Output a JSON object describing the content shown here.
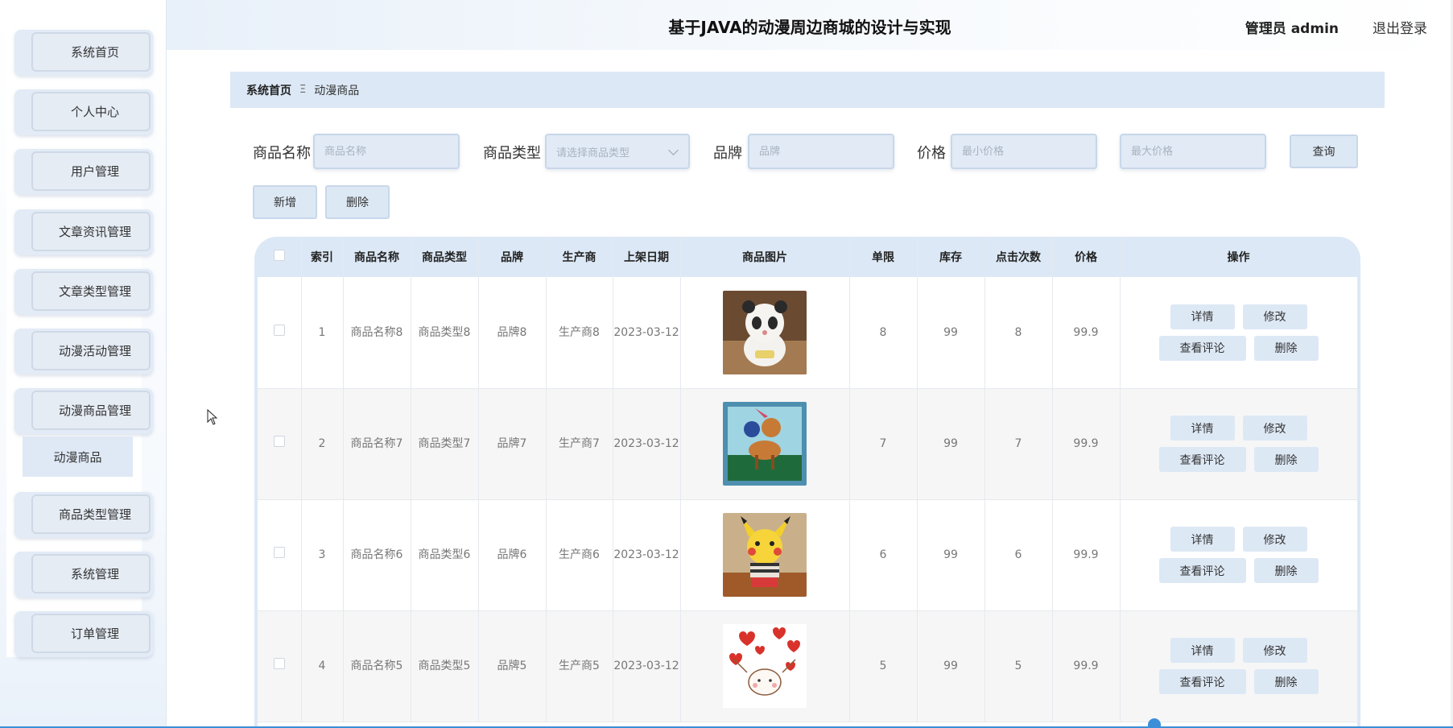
{
  "header": {
    "title": "基于JAVA的动漫周边商城的设计与实现",
    "user": "管理员 admin",
    "logout": "退出登录"
  },
  "sidebar": {
    "items": [
      {
        "label": "系统首页"
      },
      {
        "label": "个人中心"
      },
      {
        "label": "用户管理"
      },
      {
        "label": "文章资讯管理"
      },
      {
        "label": "文章类型管理"
      },
      {
        "label": "动漫活动管理"
      },
      {
        "label": "动漫商品管理"
      },
      {
        "label": "商品类型管理"
      },
      {
        "label": "系统管理"
      },
      {
        "label": "订单管理"
      }
    ],
    "submenu": {
      "label": "动漫商品"
    }
  },
  "breadcrumb": {
    "home": "系统首页",
    "separator": "Ξ",
    "current": "动漫商品"
  },
  "search": {
    "name_label": "商品名称",
    "name_placeholder": "商品名称",
    "type_label": "商品类型",
    "type_placeholder": "请选择商品类型",
    "brand_label": "品牌",
    "brand_placeholder": "品牌",
    "price_label": "价格",
    "min_price_placeholder": "最小价格",
    "max_price_placeholder": "最大价格",
    "query_button": "查询"
  },
  "actions": {
    "add": "新增",
    "delete": "删除"
  },
  "table": {
    "columns": [
      "索引",
      "商品名称",
      "商品类型",
      "品牌",
      "生产商",
      "上架日期",
      "商品图片",
      "单限",
      "库存",
      "点击次数",
      "价格",
      "操作"
    ],
    "rows": [
      {
        "index": "1",
        "name": "商品名称8",
        "type": "商品类型8",
        "brand": "品牌8",
        "maker": "生产商8",
        "date": "2023-03-12",
        "image": "panda-plush",
        "limit": "8",
        "stock": "99",
        "clicks": "8",
        "price": "99.9"
      },
      {
        "index": "2",
        "name": "商品名称7",
        "type": "商品类型7",
        "brand": "品牌7",
        "maker": "生产商7",
        "date": "2023-03-12",
        "image": "bambi-painting",
        "limit": "7",
        "stock": "99",
        "clicks": "7",
        "price": "99.9"
      },
      {
        "index": "3",
        "name": "商品名称6",
        "type": "商品类型6",
        "brand": "品牌6",
        "maker": "生产商6",
        "date": "2023-03-12",
        "image": "pikachu-plush",
        "limit": "6",
        "stock": "99",
        "clicks": "6",
        "price": "99.9"
      },
      {
        "index": "4",
        "name": "商品名称5",
        "type": "商品类型5",
        "brand": "品牌5",
        "maker": "生产商5",
        "date": "2023-03-12",
        "image": "hearts-sticker",
        "limit": "5",
        "stock": "99",
        "clicks": "5",
        "price": "99.9"
      }
    ],
    "op_labels": {
      "detail": "详情",
      "edit": "修改",
      "review": "查看评论",
      "delete": "删除"
    }
  },
  "colors": {
    "accent": "#dce8f5",
    "button_bg": "#dde8f5",
    "scrollbar": "#3b8fd8"
  }
}
